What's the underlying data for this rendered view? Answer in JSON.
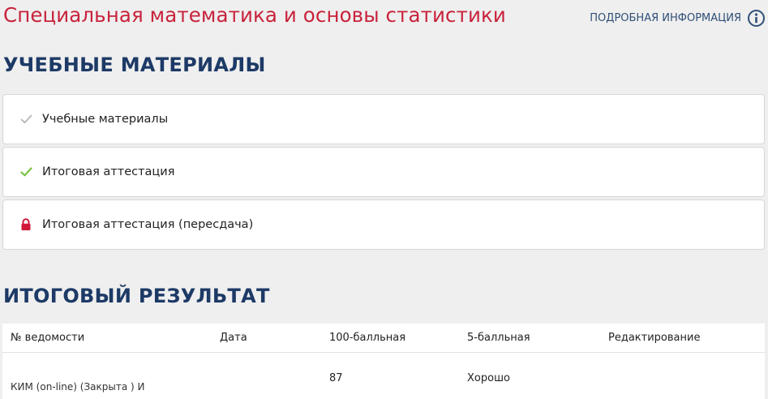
{
  "course": {
    "title": "Специальная математика и основы статистики",
    "info_link": "ПОДРОБНАЯ ИНФОРМАЦИЯ"
  },
  "materials": {
    "section_title": "УЧЕБНЫЕ МАТЕРИАЛЫ",
    "items": [
      {
        "label": "Учебные материалы",
        "icon": "check-icon",
        "status": "pending",
        "color": "#b5b5b5"
      },
      {
        "label": "Итоговая аттестация",
        "icon": "check-icon",
        "status": "complete",
        "color": "#7cc242"
      },
      {
        "label": "Итоговая аттестация (пересдача)",
        "icon": "lock-icon",
        "status": "locked",
        "color": "#d0193a"
      }
    ]
  },
  "results": {
    "section_title": "ИТОГОВЫЙ РЕЗУЛЬТАТ",
    "columns": [
      "№ ведомости",
      "Дата",
      "100-балльная",
      "5-балльная",
      "Редактирование"
    ],
    "rows": [
      {
        "sheet": "КИМ (on-line) (Закрыта ) И",
        "date": "",
        "score_100": "87",
        "score_5": "Хорошо",
        "edit": ""
      }
    ]
  },
  "colors": {
    "accent_red": "#c8233c",
    "navy": "#1d3a66",
    "link": "#2f4f77",
    "background": "#efefef"
  }
}
